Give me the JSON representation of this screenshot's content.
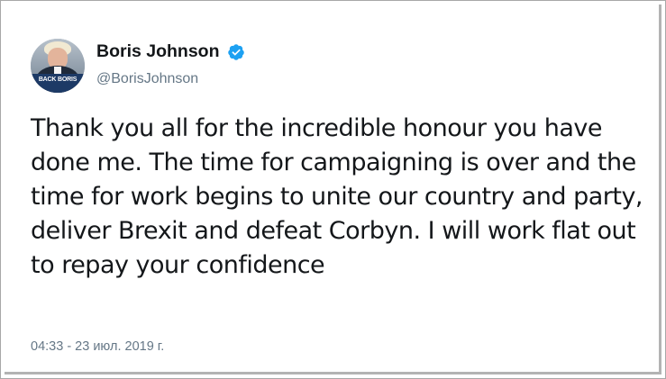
{
  "author": {
    "display_name": "Boris Johnson",
    "handle": "@BorisJohnson",
    "verified": true,
    "avatar_badge_text": "BACK BORIS"
  },
  "tweet": {
    "text": "Thank you all for the incredible honour you have done me. The time for campaigning is over and the time for work begins to unite our country and party, deliver Brexit and defeat Corbyn. I will work flat out to repay your confidence",
    "timestamp": "04:33 - 23 июл. 2019 г."
  },
  "colors": {
    "text_primary": "#14171a",
    "text_secondary": "#657786",
    "verified_badge": "#1da1f2"
  },
  "icons": {
    "verified": "verified-check-icon"
  }
}
